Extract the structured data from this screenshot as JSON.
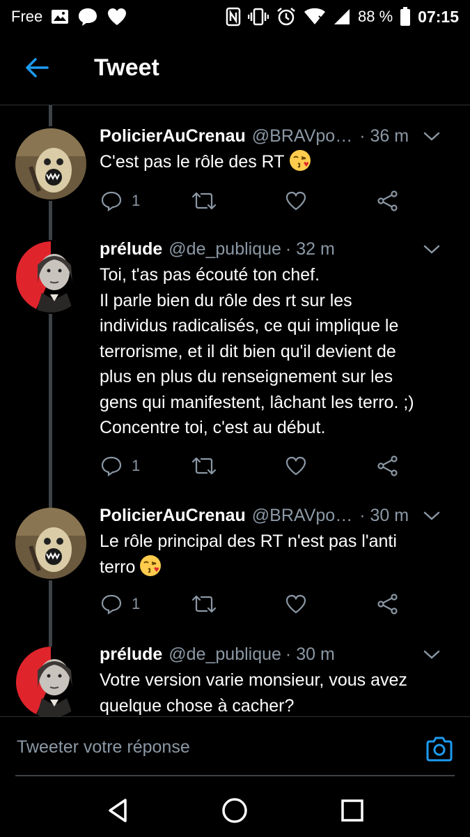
{
  "status_bar": {
    "carrier": "Free",
    "battery": "88 %",
    "time": "07:15",
    "icons": [
      "image-icon",
      "chat-bubble-icon",
      "heart-icon",
      "nfc-icon",
      "vibrate-icon",
      "alarm-icon",
      "wifi-icon",
      "signal-icon",
      "battery-icon"
    ]
  },
  "header": {
    "title": "Tweet",
    "back_icon": "arrow-left-icon"
  },
  "tweets": [
    {
      "name": "PolicierAuCrenau",
      "handle": "@BRAVpo…",
      "time": "· 36 m",
      "lines": [
        "C'est pas le rôle des RT"
      ],
      "emoji_end": "kissing-face-emoji",
      "reply_count": "1"
    },
    {
      "name": "prélude",
      "handle": "@de_publique",
      "time": "· 32 m",
      "lines": [
        "Toi, t'as pas écouté ton chef.",
        "Il parle bien du rôle des rt sur les",
        "individus radicalisés, ce qui implique le",
        "terrorisme, et il dit bien qu'il devient de",
        "plus en plus du renseignement sur les",
        "gens qui manifestent, lâchant les terro. ;)",
        "Concentre toi, c'est au début."
      ],
      "reply_count": "1"
    },
    {
      "name": "PolicierAuCrenau",
      "handle": "@BRAVpo…",
      "time": "· 30 m",
      "lines": [
        "Le rôle principal des RT n'est pas l'anti",
        "terro"
      ],
      "emoji_end": "kissing-face-emoji",
      "reply_count": "1"
    },
    {
      "name": "prélude",
      "handle": "@de_publique",
      "time": "· 30 m",
      "lines": [
        "Votre version varie monsieur, vous avez",
        "quelque chose à cacher?"
      ]
    }
  ],
  "reply_bar": {
    "placeholder": "Tweeter votre réponse",
    "icon": "camera-icon"
  },
  "navbar": {
    "icons": [
      "back-triangle-icon",
      "home-circle-icon",
      "recents-square-icon"
    ]
  },
  "colors": {
    "background": "#000000",
    "accent": "#1d9bf0",
    "muted": "#8b98a5",
    "emoji": "#ffcc4d",
    "avatar_red": "#e0242c"
  }
}
